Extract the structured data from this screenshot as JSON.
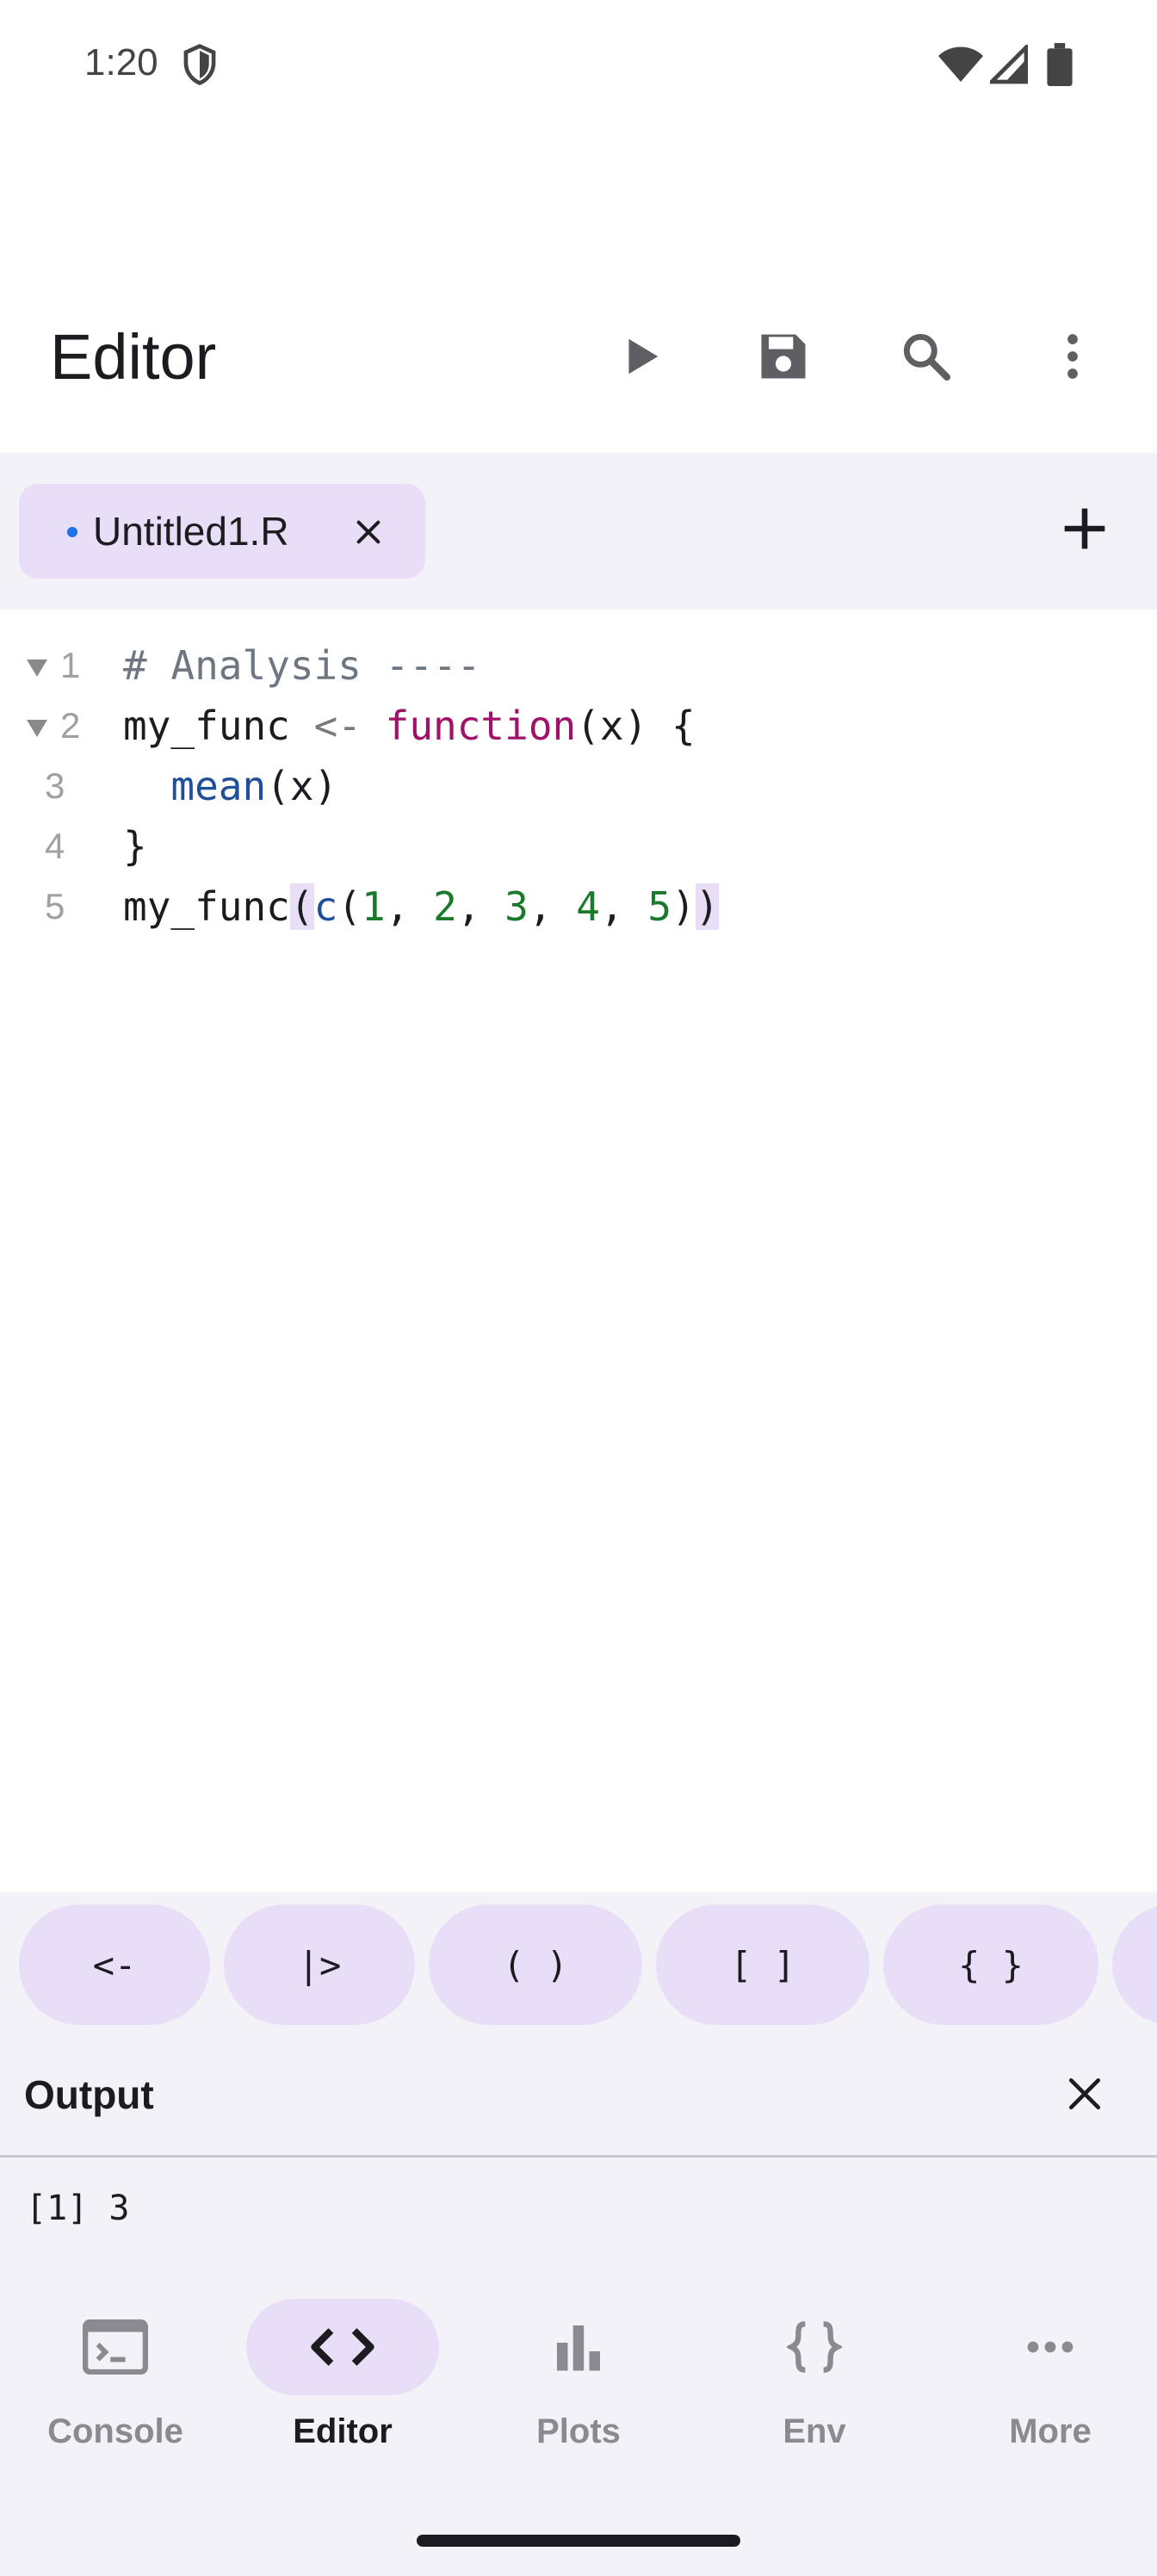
{
  "status_bar": {
    "time": "1:20"
  },
  "app_bar": {
    "title": "Editor",
    "actions": [
      "play-icon",
      "save-icon",
      "search-icon",
      "more-vert-icon"
    ]
  },
  "tabs": {
    "items": [
      {
        "label": "Untitled1.R",
        "modified": true
      }
    ],
    "add_icon": "plus-icon"
  },
  "editor": {
    "line_numbers": [
      "1",
      "2",
      "3",
      "4",
      "5"
    ],
    "lines": [
      "# Analysis ----",
      "my_func <- function(x) {",
      "  mean(x)",
      "}",
      "my_func(c(1, 2, 3, 4, 5))"
    ]
  },
  "shortcuts": [
    "<-",
    "|>",
    "( )",
    "[ ]",
    "{ }"
  ],
  "output": {
    "title": "Output",
    "text": "[1] 3"
  },
  "bottom_nav": {
    "items": [
      {
        "label": "Console",
        "icon": "terminal-icon",
        "active": false
      },
      {
        "label": "Editor",
        "icon": "code-icon",
        "active": true
      },
      {
        "label": "Plots",
        "icon": "bar-chart-icon",
        "active": false
      },
      {
        "label": "Env",
        "icon": "braces-icon",
        "active": false
      },
      {
        "label": "More",
        "icon": "more-horiz-icon",
        "active": false
      }
    ]
  },
  "colors": {
    "accent_container": "#e8def8",
    "surface_variant": "#f3f2f7",
    "modified_dot": "#1a73e8"
  }
}
